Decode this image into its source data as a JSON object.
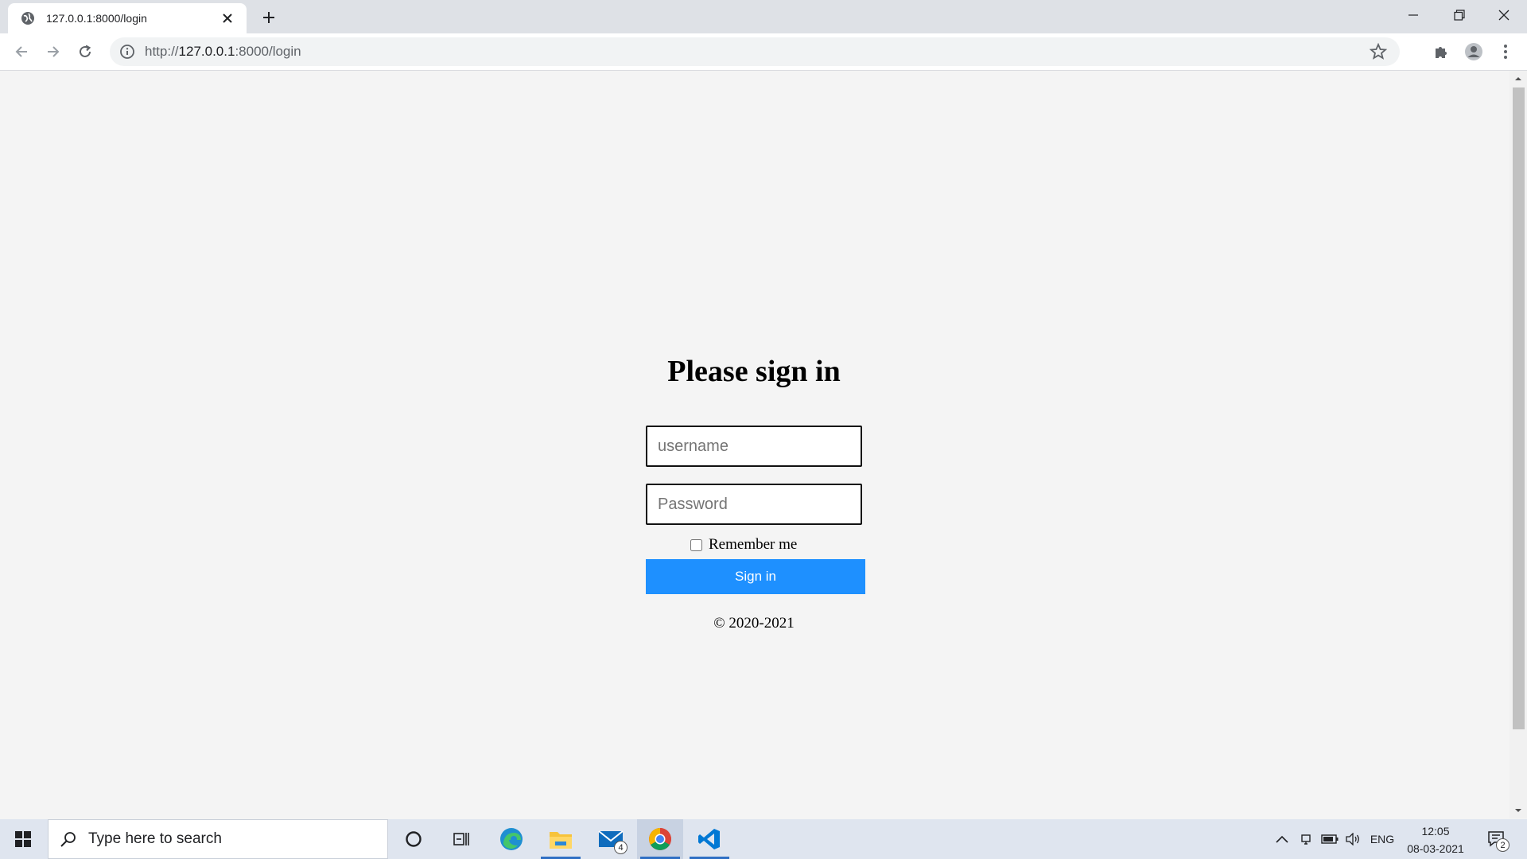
{
  "browser": {
    "tab": {
      "title": "127.0.0.1:8000/login"
    },
    "address": {
      "scheme": "http://",
      "host": "127.0.0.1",
      "path": ":8000/login"
    }
  },
  "login": {
    "heading": "Please sign in",
    "username_placeholder": "username",
    "password_placeholder": "Password",
    "remember_label": "Remember me",
    "signin_label": "Sign in",
    "copyright": "© 2020-2021"
  },
  "taskbar": {
    "search_placeholder": "Type here to search",
    "mail_badge": "4",
    "language": "ENG",
    "time": "12:05",
    "date": "08-03-2021",
    "notification_count": "2"
  },
  "colors": {
    "accent": "#1e90ff",
    "page_background": "#f4f4f4",
    "taskbar": "#dfe5ef"
  }
}
